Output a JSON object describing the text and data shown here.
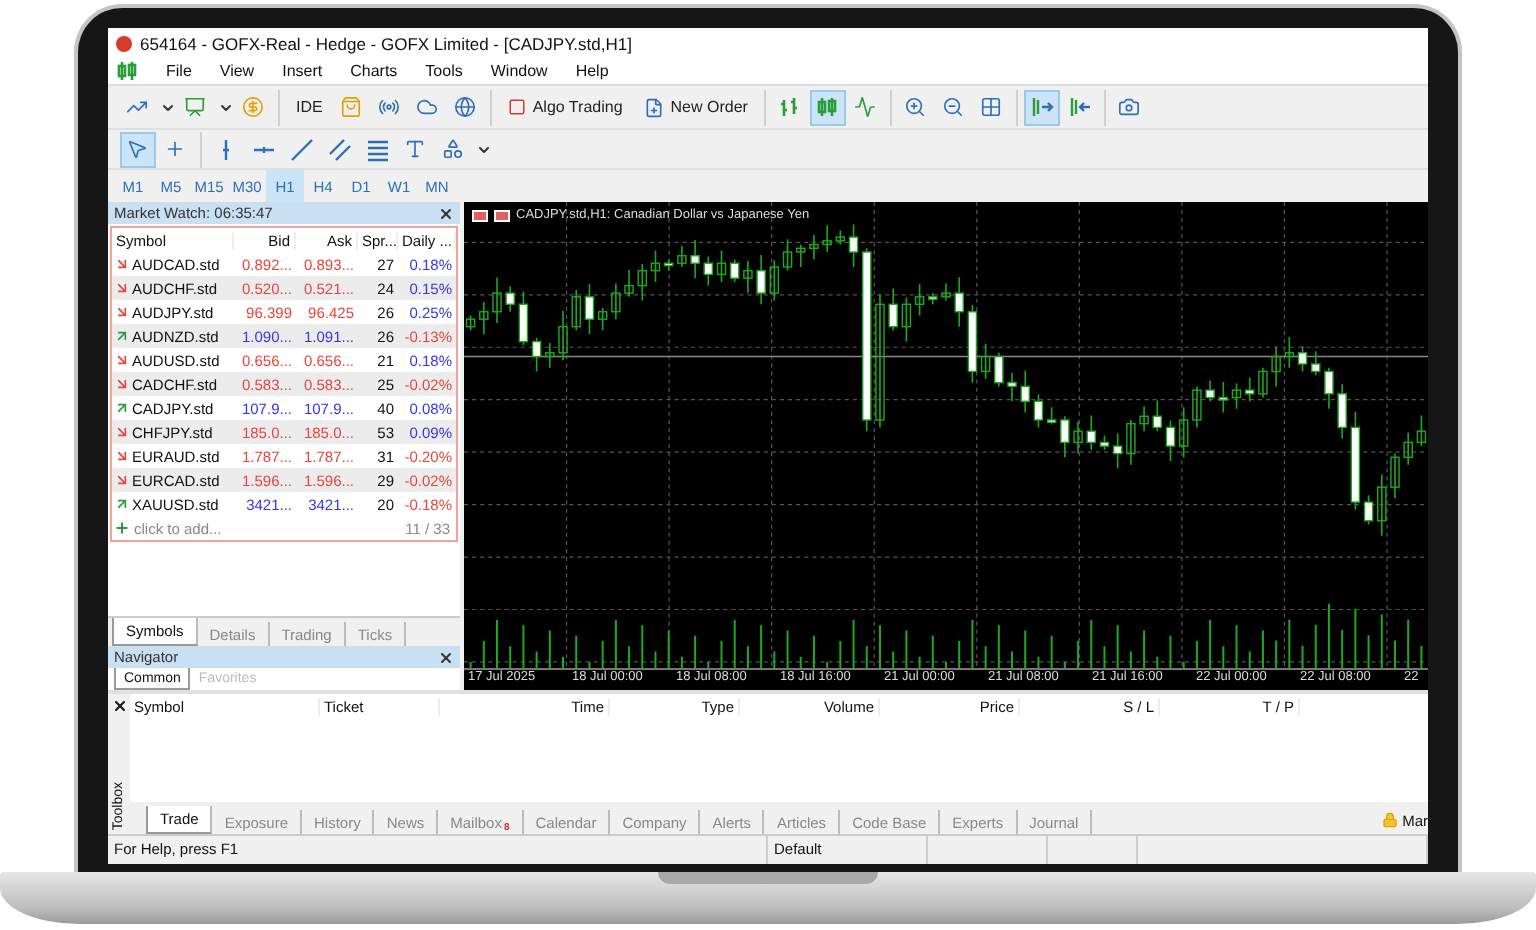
{
  "window": {
    "title": "654164 - GOFX-Real - Hedge - GOFX Limited - [CADJPY.std,H1]"
  },
  "menu": [
    "File",
    "View",
    "Insert",
    "Charts",
    "Tools",
    "Window",
    "Help"
  ],
  "toolbar": {
    "groups": [
      [
        {
          "kind": "icon",
          "selected": false
        },
        {
          "kind": "caret"
        },
        {
          "kind": "icon",
          "selected": false
        },
        {
          "kind": "caret"
        },
        {
          "kind": "icon",
          "selected": false
        }
      ],
      [
        {
          "kind": "text",
          "label": "IDE",
          "selected": false
        },
        {
          "kind": "icon",
          "selected": false
        },
        {
          "kind": "icon",
          "selected": false
        },
        {
          "kind": "icon",
          "selected": false
        },
        {
          "kind": "icon",
          "selected": false
        }
      ],
      [
        {
          "kind": "text",
          "label": "Algo Trading",
          "selected": false
        },
        {
          "kind": "text",
          "label": "New Order",
          "selected": false
        }
      ],
      [
        {
          "kind": "icon",
          "selected": false
        },
        {
          "kind": "icon",
          "selected": true
        },
        {
          "kind": "icon",
          "selected": false
        }
      ],
      [
        {
          "kind": "icon",
          "selected": false
        },
        {
          "kind": "icon",
          "selected": false
        },
        {
          "kind": "icon",
          "selected": false
        }
      ],
      [
        {
          "kind": "icon",
          "selected": true
        },
        {
          "kind": "icon",
          "selected": false
        }
      ],
      [
        {
          "kind": "icon",
          "selected": false
        }
      ]
    ]
  },
  "drawing_tools": {
    "groups": [
      [
        {
          "kind": "icon",
          "selected": true
        },
        {
          "kind": "icon",
          "selected": false
        }
      ],
      [
        {
          "kind": "icon",
          "selected": false
        },
        {
          "kind": "icon",
          "selected": false
        },
        {
          "kind": "icon",
          "selected": false
        },
        {
          "kind": "icon",
          "selected": false
        },
        {
          "kind": "icon",
          "selected": false
        },
        {
          "kind": "icon",
          "selected": false
        },
        {
          "kind": "icon",
          "selected": false
        },
        {
          "kind": "caret"
        }
      ]
    ]
  },
  "timeframes": [
    {
      "label": "M1",
      "selected": false
    },
    {
      "label": "M5",
      "selected": false
    },
    {
      "label": "M15",
      "selected": false
    },
    {
      "label": "M30",
      "selected": false
    },
    {
      "label": "H1",
      "selected": true
    },
    {
      "label": "H4",
      "selected": false
    },
    {
      "label": "D1",
      "selected": false
    },
    {
      "label": "W1",
      "selected": false
    },
    {
      "label": "MN",
      "selected": false
    }
  ],
  "market_watch": {
    "title": "Market Watch: 06:35:47",
    "columns": [
      "Symbol",
      "Bid",
      "Ask",
      "Spr...",
      "Daily ..."
    ],
    "rows": [
      {
        "symbol": "AUDCAD.std",
        "bid": "0.892...",
        "ask": "0.893...",
        "spread": "27",
        "daily": "0.18%",
        "rising": false,
        "change_positive": true
      },
      {
        "symbol": "AUDCHF.std",
        "bid": "0.520...",
        "ask": "0.521...",
        "spread": "24",
        "daily": "0.15%",
        "rising": false,
        "change_positive": true
      },
      {
        "symbol": "AUDJPY.std",
        "bid": "96.399",
        "ask": "96.425",
        "spread": "26",
        "daily": "0.25%",
        "rising": false,
        "change_positive": true
      },
      {
        "symbol": "AUDNZD.std",
        "bid": "1.090...",
        "ask": "1.091...",
        "spread": "26",
        "daily": "-0.13%",
        "rising": true,
        "change_positive": false
      },
      {
        "symbol": "AUDUSD.std",
        "bid": "0.656...",
        "ask": "0.656...",
        "spread": "21",
        "daily": "0.18%",
        "rising": false,
        "change_positive": true
      },
      {
        "symbol": "CADCHF.std",
        "bid": "0.583...",
        "ask": "0.583...",
        "spread": "25",
        "daily": "-0.02%",
        "rising": false,
        "change_positive": false
      },
      {
        "symbol": "CADJPY.std",
        "bid": "107.9...",
        "ask": "107.9...",
        "spread": "40",
        "daily": "0.08%",
        "rising": true,
        "change_positive": true
      },
      {
        "symbol": "CHFJPY.std",
        "bid": "185.0...",
        "ask": "185.0...",
        "spread": "53",
        "daily": "0.09%",
        "rising": false,
        "change_positive": true
      },
      {
        "symbol": "EURAUD.std",
        "bid": "1.787...",
        "ask": "1.787...",
        "spread": "31",
        "daily": "-0.20%",
        "rising": false,
        "change_positive": false
      },
      {
        "symbol": "EURCAD.std",
        "bid": "1.596...",
        "ask": "1.596...",
        "spread": "29",
        "daily": "-0.02%",
        "rising": false,
        "change_positive": false
      },
      {
        "symbol": "XAUUSD.std",
        "bid": "3421...",
        "ask": "3421...",
        "spread": "20",
        "daily": "-0.18%",
        "rising": true,
        "change_positive": false
      }
    ],
    "add_row": "click to add...",
    "count": "11 / 33",
    "tabs": [
      {
        "label": "Symbols",
        "selected": true
      },
      {
        "label": "Details",
        "selected": false
      },
      {
        "label": "Trading",
        "selected": false
      },
      {
        "label": "Ticks",
        "selected": false
      }
    ]
  },
  "navigator": {
    "title": "Navigator",
    "tabs": [
      {
        "label": "Common",
        "selected": true
      },
      {
        "label": "Favorites",
        "selected": false
      }
    ]
  },
  "chart": {
    "title": "CADJPY.std,H1:  Canadian Dollar vs Japanese Yen",
    "time_labels": [
      "17 Jul 2025",
      "18 Jul 00:00",
      "18 Jul 08:00",
      "18 Jul 16:00",
      "21 Jul 00:00",
      "21 Jul 08:00",
      "21 Jul 16:00",
      "22 Jul 00:00",
      "22 Jul 08:00",
      "22"
    ]
  },
  "toolbox": {
    "label": "Toolbox",
    "columns": [
      "Symbol",
      "Ticket",
      "Time",
      "Type",
      "Volume",
      "Price",
      "S / L",
      "T / P"
    ],
    "tabs": [
      {
        "label": "Trade",
        "selected": true
      },
      {
        "label": "Exposure",
        "selected": false
      },
      {
        "label": "History",
        "selected": false
      },
      {
        "label": "News",
        "selected": false
      },
      {
        "label": "Mailbox",
        "selected": false,
        "badge": "8"
      },
      {
        "label": "Calendar",
        "selected": false
      },
      {
        "label": "Company",
        "selected": false
      },
      {
        "label": "Alerts",
        "selected": false
      },
      {
        "label": "Articles",
        "selected": false
      },
      {
        "label": "Code Base",
        "selected": false
      },
      {
        "label": "Experts",
        "selected": false
      },
      {
        "label": "Journal",
        "selected": false
      }
    ],
    "market_tab": "Mar"
  },
  "status_bar": {
    "help": "For Help, press F1",
    "profile": "Default"
  }
}
